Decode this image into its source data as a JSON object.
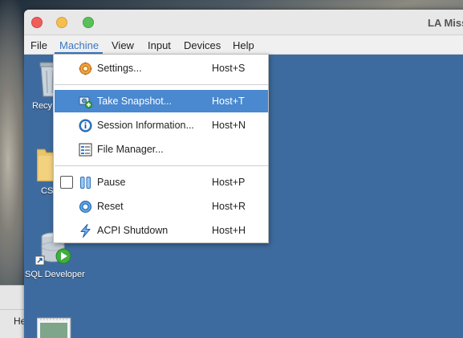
{
  "window": {
    "title": "LA Miss"
  },
  "menubar": {
    "items": [
      "File",
      "Machine",
      "View",
      "Input",
      "Devices",
      "Help"
    ],
    "active": "Machine"
  },
  "desktop_icons": {
    "recycle_label": "Recy",
    "csv_label": "CS",
    "sql_label": "SQL Developer"
  },
  "host_panel": {
    "label": "He"
  },
  "menu": {
    "items": [
      {
        "label": "Settings...",
        "shortcut": "Host+S",
        "icon": "gear-icon"
      },
      {
        "label": "Take Snapshot...",
        "shortcut": "Host+T",
        "icon": "snapshot-icon",
        "highlighted": true
      },
      {
        "label": "Session Information...",
        "shortcut": "Host+N",
        "icon": "info-icon"
      },
      {
        "label": "File Manager...",
        "shortcut": "",
        "icon": "file-manager-icon"
      },
      {
        "label": "Pause",
        "shortcut": "Host+P",
        "icon": "pause-icon",
        "checkbox": true
      },
      {
        "label": "Reset",
        "shortcut": "Host+R",
        "icon": "reset-icon"
      },
      {
        "label": "ACPI Shutdown",
        "shortcut": "Host+H",
        "icon": "acpi-shutdown-icon"
      }
    ]
  },
  "colors": {
    "guest_desktop": "#3e6b9f",
    "menu_highlight": "#4a88cf",
    "menubar_active": "#3a78c2"
  }
}
